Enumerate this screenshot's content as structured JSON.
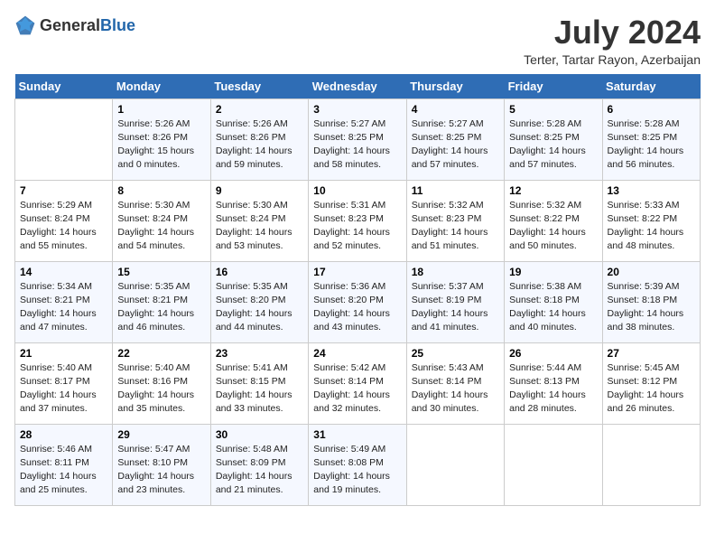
{
  "header": {
    "logo_general": "General",
    "logo_blue": "Blue",
    "title": "July 2024",
    "subtitle": "Terter, Tartar Rayon, Azerbaijan"
  },
  "weekdays": [
    "Sunday",
    "Monday",
    "Tuesday",
    "Wednesday",
    "Thursday",
    "Friday",
    "Saturday"
  ],
  "weeks": [
    [
      {
        "day": "",
        "sunrise": "",
        "sunset": "",
        "daylight": ""
      },
      {
        "day": "1",
        "sunrise": "Sunrise: 5:26 AM",
        "sunset": "Sunset: 8:26 PM",
        "daylight": "Daylight: 15 hours and 0 minutes."
      },
      {
        "day": "2",
        "sunrise": "Sunrise: 5:26 AM",
        "sunset": "Sunset: 8:26 PM",
        "daylight": "Daylight: 14 hours and 59 minutes."
      },
      {
        "day": "3",
        "sunrise": "Sunrise: 5:27 AM",
        "sunset": "Sunset: 8:25 PM",
        "daylight": "Daylight: 14 hours and 58 minutes."
      },
      {
        "day": "4",
        "sunrise": "Sunrise: 5:27 AM",
        "sunset": "Sunset: 8:25 PM",
        "daylight": "Daylight: 14 hours and 57 minutes."
      },
      {
        "day": "5",
        "sunrise": "Sunrise: 5:28 AM",
        "sunset": "Sunset: 8:25 PM",
        "daylight": "Daylight: 14 hours and 57 minutes."
      },
      {
        "day": "6",
        "sunrise": "Sunrise: 5:28 AM",
        "sunset": "Sunset: 8:25 PM",
        "daylight": "Daylight: 14 hours and 56 minutes."
      }
    ],
    [
      {
        "day": "7",
        "sunrise": "Sunrise: 5:29 AM",
        "sunset": "Sunset: 8:24 PM",
        "daylight": "Daylight: 14 hours and 55 minutes."
      },
      {
        "day": "8",
        "sunrise": "Sunrise: 5:30 AM",
        "sunset": "Sunset: 8:24 PM",
        "daylight": "Daylight: 14 hours and 54 minutes."
      },
      {
        "day": "9",
        "sunrise": "Sunrise: 5:30 AM",
        "sunset": "Sunset: 8:24 PM",
        "daylight": "Daylight: 14 hours and 53 minutes."
      },
      {
        "day": "10",
        "sunrise": "Sunrise: 5:31 AM",
        "sunset": "Sunset: 8:23 PM",
        "daylight": "Daylight: 14 hours and 52 minutes."
      },
      {
        "day": "11",
        "sunrise": "Sunrise: 5:32 AM",
        "sunset": "Sunset: 8:23 PM",
        "daylight": "Daylight: 14 hours and 51 minutes."
      },
      {
        "day": "12",
        "sunrise": "Sunrise: 5:32 AM",
        "sunset": "Sunset: 8:22 PM",
        "daylight": "Daylight: 14 hours and 50 minutes."
      },
      {
        "day": "13",
        "sunrise": "Sunrise: 5:33 AM",
        "sunset": "Sunset: 8:22 PM",
        "daylight": "Daylight: 14 hours and 48 minutes."
      }
    ],
    [
      {
        "day": "14",
        "sunrise": "Sunrise: 5:34 AM",
        "sunset": "Sunset: 8:21 PM",
        "daylight": "Daylight: 14 hours and 47 minutes."
      },
      {
        "day": "15",
        "sunrise": "Sunrise: 5:35 AM",
        "sunset": "Sunset: 8:21 PM",
        "daylight": "Daylight: 14 hours and 46 minutes."
      },
      {
        "day": "16",
        "sunrise": "Sunrise: 5:35 AM",
        "sunset": "Sunset: 8:20 PM",
        "daylight": "Daylight: 14 hours and 44 minutes."
      },
      {
        "day": "17",
        "sunrise": "Sunrise: 5:36 AM",
        "sunset": "Sunset: 8:20 PM",
        "daylight": "Daylight: 14 hours and 43 minutes."
      },
      {
        "day": "18",
        "sunrise": "Sunrise: 5:37 AM",
        "sunset": "Sunset: 8:19 PM",
        "daylight": "Daylight: 14 hours and 41 minutes."
      },
      {
        "day": "19",
        "sunrise": "Sunrise: 5:38 AM",
        "sunset": "Sunset: 8:18 PM",
        "daylight": "Daylight: 14 hours and 40 minutes."
      },
      {
        "day": "20",
        "sunrise": "Sunrise: 5:39 AM",
        "sunset": "Sunset: 8:18 PM",
        "daylight": "Daylight: 14 hours and 38 minutes."
      }
    ],
    [
      {
        "day": "21",
        "sunrise": "Sunrise: 5:40 AM",
        "sunset": "Sunset: 8:17 PM",
        "daylight": "Daylight: 14 hours and 37 minutes."
      },
      {
        "day": "22",
        "sunrise": "Sunrise: 5:40 AM",
        "sunset": "Sunset: 8:16 PM",
        "daylight": "Daylight: 14 hours and 35 minutes."
      },
      {
        "day": "23",
        "sunrise": "Sunrise: 5:41 AM",
        "sunset": "Sunset: 8:15 PM",
        "daylight": "Daylight: 14 hours and 33 minutes."
      },
      {
        "day": "24",
        "sunrise": "Sunrise: 5:42 AM",
        "sunset": "Sunset: 8:14 PM",
        "daylight": "Daylight: 14 hours and 32 minutes."
      },
      {
        "day": "25",
        "sunrise": "Sunrise: 5:43 AM",
        "sunset": "Sunset: 8:14 PM",
        "daylight": "Daylight: 14 hours and 30 minutes."
      },
      {
        "day": "26",
        "sunrise": "Sunrise: 5:44 AM",
        "sunset": "Sunset: 8:13 PM",
        "daylight": "Daylight: 14 hours and 28 minutes."
      },
      {
        "day": "27",
        "sunrise": "Sunrise: 5:45 AM",
        "sunset": "Sunset: 8:12 PM",
        "daylight": "Daylight: 14 hours and 26 minutes."
      }
    ],
    [
      {
        "day": "28",
        "sunrise": "Sunrise: 5:46 AM",
        "sunset": "Sunset: 8:11 PM",
        "daylight": "Daylight: 14 hours and 25 minutes."
      },
      {
        "day": "29",
        "sunrise": "Sunrise: 5:47 AM",
        "sunset": "Sunset: 8:10 PM",
        "daylight": "Daylight: 14 hours and 23 minutes."
      },
      {
        "day": "30",
        "sunrise": "Sunrise: 5:48 AM",
        "sunset": "Sunset: 8:09 PM",
        "daylight": "Daylight: 14 hours and 21 minutes."
      },
      {
        "day": "31",
        "sunrise": "Sunrise: 5:49 AM",
        "sunset": "Sunset: 8:08 PM",
        "daylight": "Daylight: 14 hours and 19 minutes."
      },
      {
        "day": "",
        "sunrise": "",
        "sunset": "",
        "daylight": ""
      },
      {
        "day": "",
        "sunrise": "",
        "sunset": "",
        "daylight": ""
      },
      {
        "day": "",
        "sunrise": "",
        "sunset": "",
        "daylight": ""
      }
    ]
  ]
}
